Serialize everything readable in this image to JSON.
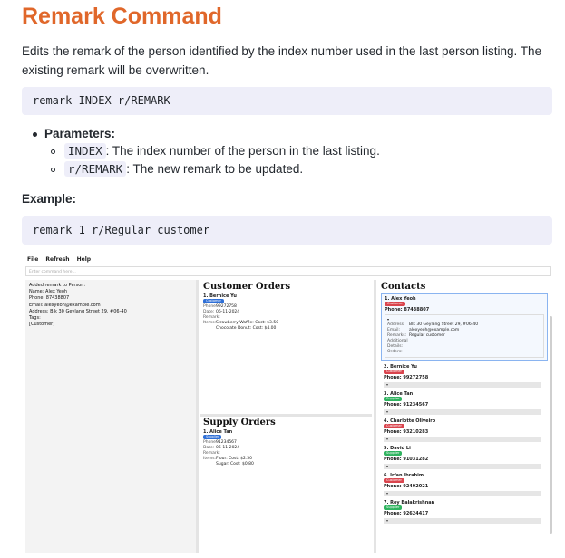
{
  "doc": {
    "title": "Remark Command",
    "desc_line1": "Edits the remark of the person identified by the index number used in the last person listing. The",
    "desc_line2": "existing remark will be overwritten.",
    "syntax": "remark INDEX r/REMARK",
    "params_heading": "Parameters:",
    "params": [
      {
        "code": "INDEX",
        "text": ": The index number of the person in the last listing."
      },
      {
        "code": "r/REMARK",
        "text": ": The new remark to be updated."
      }
    ],
    "example_heading": "Example:",
    "example": "remark 1 r/Regular customer"
  },
  "app": {
    "menu": [
      "File",
      "Refresh",
      "Help"
    ],
    "command_placeholder": "Enter command here...",
    "result_lines": [
      "Added remark to Person:",
      "Name: Alex Yeoh",
      "Phone: 87438807",
      "Email: alexyeoh@example.com",
      "Address: Blk 30 Geylang Street 29, #06-40",
      "Tags:",
      "[Customer]"
    ],
    "customer_orders": {
      "title": "Customer Orders",
      "name": "1. Bernice Yu",
      "tag": "Customer",
      "phone_label": "Phone:",
      "phone": "99272758",
      "date_label": "Date:",
      "date": "06-11-2024",
      "remark_label": "Remark:",
      "items_label": "Items:",
      "items": [
        "Strawberry Waffle: Cost: $3.50",
        "Chocolate Donut: Cost: $4.00"
      ]
    },
    "supply_orders": {
      "title": "Supply Orders",
      "name": "1. Alice Tan",
      "tag": "Supplier",
      "phone_label": "Phone:",
      "phone": "91234567",
      "date_label": "Date:",
      "date": "06-11-2024",
      "remark_label": "Remark:",
      "items_label": "Items:",
      "items": [
        "Flour: Cost: $2.50",
        "Sugar: Cost: $0.80"
      ]
    },
    "contacts": {
      "title": "Contacts",
      "selected": {
        "name": "1. Alex Yeoh",
        "tag": "Customer",
        "phone": "Phone: 87438807",
        "details": [
          {
            "k": "Address:",
            "v": "Blk 30 Geylang Street 29, #06-40"
          },
          {
            "k": "Email:",
            "v": "alexyeoh@example.com"
          },
          {
            "k": "Remarks:",
            "v": "Regular customer"
          },
          {
            "k": "Additional",
            "v": ""
          },
          {
            "k": "Details:",
            "v": ""
          },
          {
            "k": "Orders:",
            "v": ""
          }
        ]
      },
      "list": [
        {
          "name": "2. Bernice Yu",
          "tag": "Customer",
          "tag_color": "red",
          "phone": "Phone: 99272758"
        },
        {
          "name": "3. Alice Tan",
          "tag": "Supplier",
          "tag_color": "green",
          "phone": "Phone: 91234567"
        },
        {
          "name": "4. Charlotte Oliveiro",
          "tag": "Customer",
          "tag_color": "red",
          "phone": "Phone: 93210283"
        },
        {
          "name": "5. David Li",
          "tag": "Supplier",
          "tag_color": "green",
          "phone": "Phone: 91031282"
        },
        {
          "name": "6. Irfan Ibrahim",
          "tag": "Customer",
          "tag_color": "red",
          "phone": "Phone: 92492021"
        },
        {
          "name": "7. Roy Balakrishnan",
          "tag": "Supplier",
          "tag_color": "green",
          "phone": "Phone: 92624417"
        }
      ]
    }
  }
}
